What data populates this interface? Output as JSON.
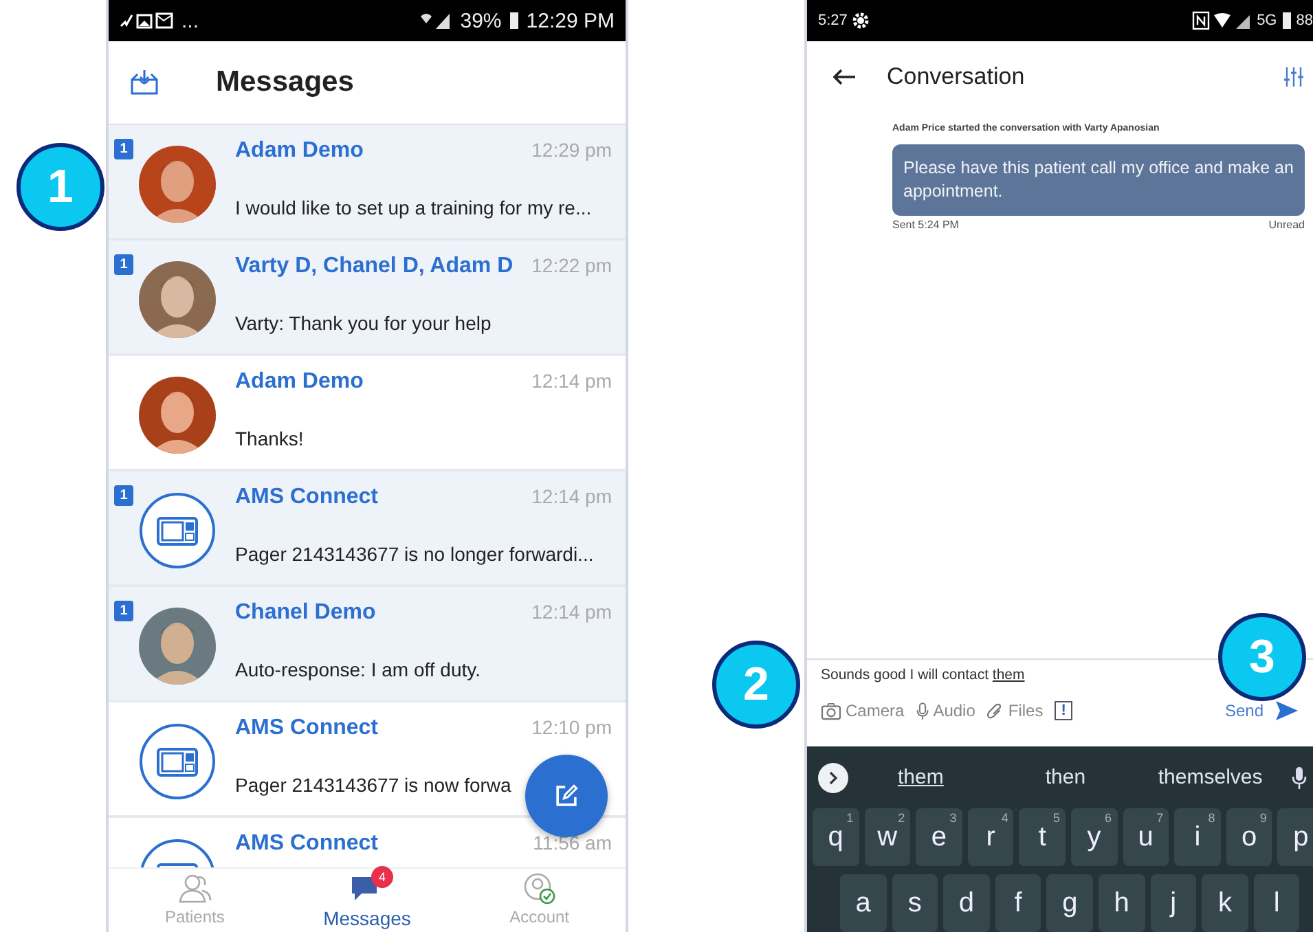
{
  "left_phone": {
    "status_bar": {
      "overflow": "...",
      "battery": "39%",
      "time": "12:29 PM"
    },
    "title": "Messages",
    "conversations": [
      {
        "name": "Adam Demo",
        "time": "12:29 pm",
        "preview": "I would like to set up a training for my re...",
        "unread": true,
        "unread_count": "1"
      },
      {
        "name": "Varty D, Chanel D, Adam D",
        "time": "12:22 pm",
        "preview": "Varty: Thank you for your help",
        "unread": true,
        "unread_count": "1"
      },
      {
        "name": "Adam Demo",
        "time": "12:14 pm",
        "preview": "Thanks!",
        "unread": false
      },
      {
        "name": "AMS Connect",
        "time": "12:14 pm",
        "preview": "Pager 2143143677 is no longer forwardi...",
        "unread": true,
        "unread_count": "1",
        "kind": "device"
      },
      {
        "name": "Chanel Demo",
        "time": "12:14 pm",
        "preview": "Auto-response: I am off duty.",
        "unread": true,
        "unread_count": "1"
      },
      {
        "name": "AMS Connect",
        "time": "12:10 pm",
        "preview": "Pager 2143143677 is now forwa",
        "unread": false,
        "kind": "device"
      },
      {
        "name": "AMS Connect",
        "time": "11:56 am",
        "unread": false,
        "kind": "device"
      }
    ],
    "nav": [
      {
        "label": "Patients",
        "selected": false
      },
      {
        "label": "Messages",
        "selected": true,
        "badge": "4"
      },
      {
        "label": "Account",
        "selected": false
      }
    ]
  },
  "right_phone": {
    "status_bar": {
      "time": "5:27",
      "network": "5G",
      "battery": "88"
    },
    "title": "Conversation",
    "system_note": "Adam Price started the conversation with Varty Apanosian",
    "message": {
      "text": "Please have this patient call my office and make an appointment.",
      "sent": "Sent 5:24 PM",
      "status": "Unread"
    },
    "composer": {
      "value": "Sounds good I will contact ",
      "composing": "them"
    },
    "attachments": [
      "Camera",
      "Audio",
      "Files"
    ],
    "priority": "!",
    "send": "Send",
    "suggestions": [
      {
        "text": "them",
        "selected": true
      },
      {
        "text": "then",
        "selected": false
      },
      {
        "text": "themselves",
        "selected": false
      }
    ],
    "keys": [
      [
        {
          "k": "q",
          "hint": "1"
        },
        {
          "k": "w",
          "hint": "2"
        },
        {
          "k": "e",
          "hint": "3"
        },
        {
          "k": "r",
          "hint": "4"
        },
        {
          "k": "t",
          "hint": "5"
        },
        {
          "k": "y",
          "hint": "6"
        },
        {
          "k": "u",
          "hint": "7"
        },
        {
          "k": "i",
          "hint": "8"
        },
        {
          "k": "o",
          "hint": "9"
        },
        {
          "k": "p"
        }
      ],
      [
        {
          "k": "a"
        },
        {
          "k": "s"
        },
        {
          "k": "d"
        },
        {
          "k": "f"
        },
        {
          "k": "g"
        },
        {
          "k": "h"
        },
        {
          "k": "j"
        },
        {
          "k": "k"
        },
        {
          "k": "l"
        }
      ]
    ]
  },
  "callouts": [
    "1",
    "2",
    "3"
  ]
}
